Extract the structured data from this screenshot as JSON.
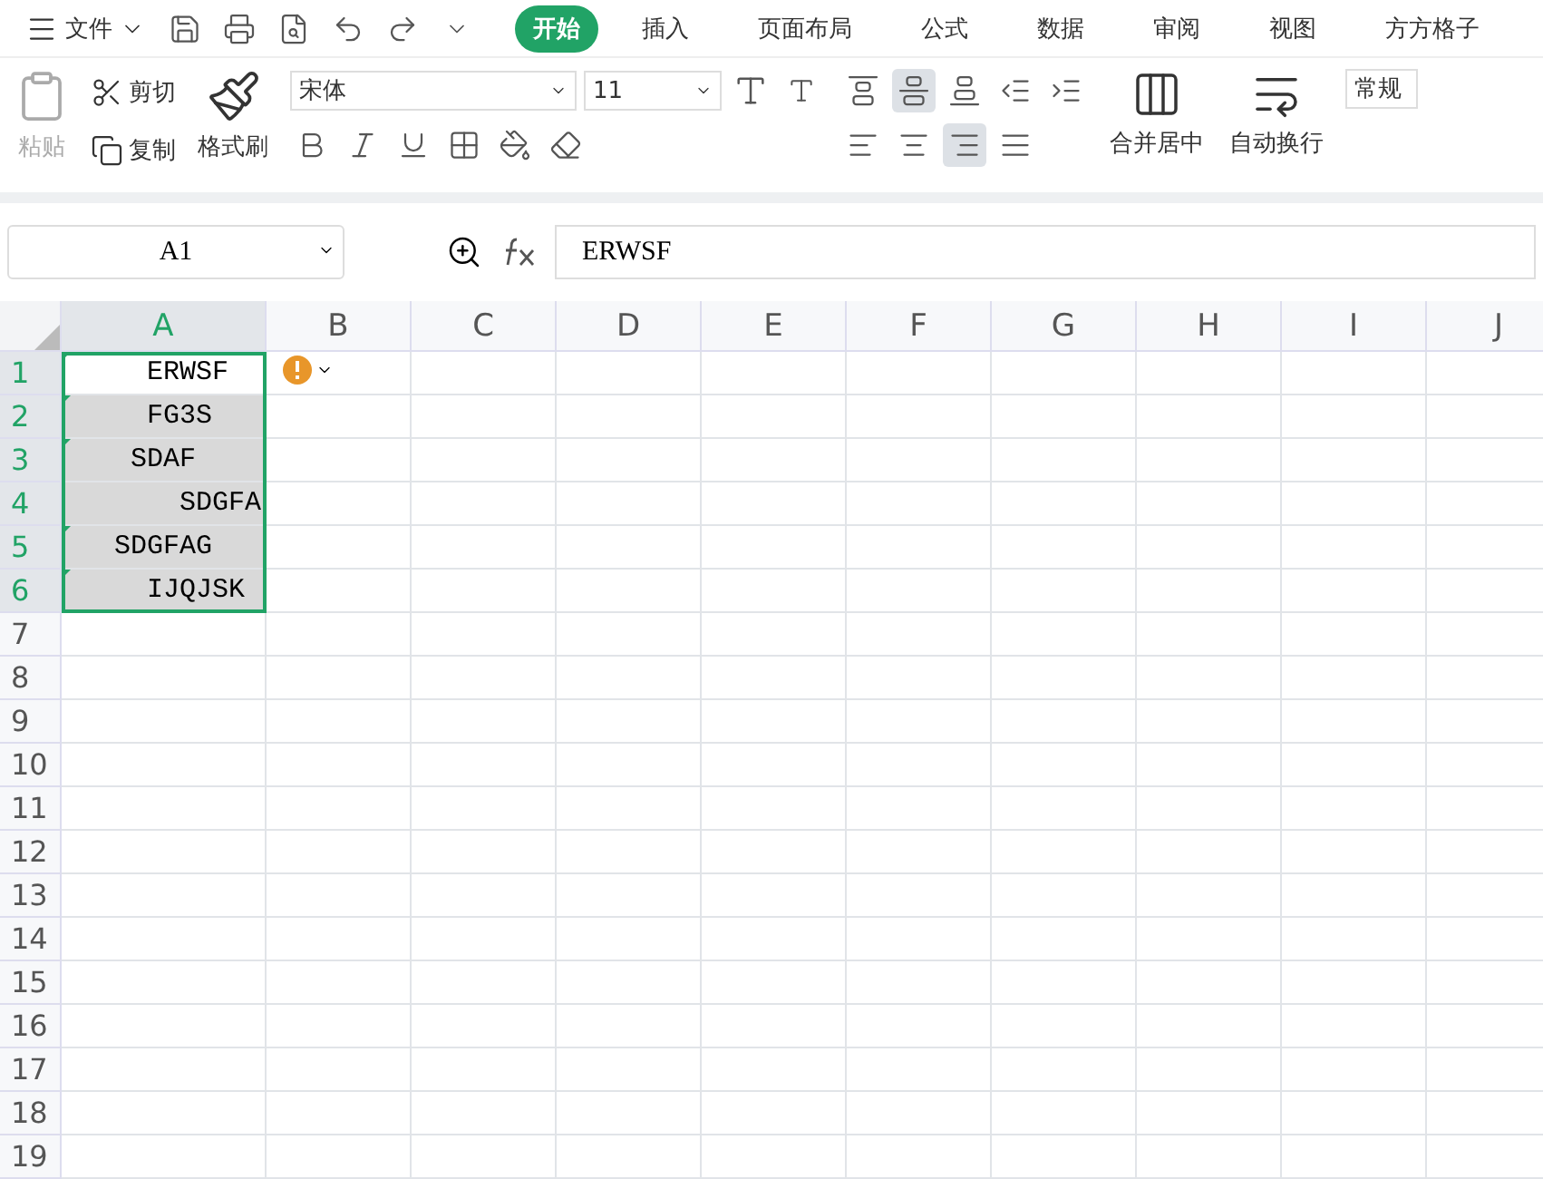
{
  "menu": {
    "label": "文件"
  },
  "tabs": [
    {
      "label": "开始",
      "selected": true
    },
    {
      "label": "插入",
      "selected": false
    },
    {
      "label": "页面布局",
      "selected": false
    },
    {
      "label": "公式",
      "selected": false
    },
    {
      "label": "数据",
      "selected": false
    },
    {
      "label": "审阅",
      "selected": false
    },
    {
      "label": "视图",
      "selected": false
    },
    {
      "label": "方方格子",
      "selected": false
    }
  ],
  "ribbon": {
    "paste": "粘贴",
    "cut": "剪切",
    "copy": "复制",
    "format_painter": "格式刷",
    "font_name": "宋体",
    "font_size": "11",
    "merge": "合并居中",
    "wrap": "自动换行",
    "number_format": "常规",
    "vertical_align": [
      {
        "kind": "top",
        "selected": false
      },
      {
        "kind": "middle",
        "selected": true
      },
      {
        "kind": "bottom",
        "selected": false
      }
    ],
    "horizontal_align": [
      {
        "kind": "left",
        "selected": false
      },
      {
        "kind": "center",
        "selected": false
      },
      {
        "kind": "right",
        "selected": true
      },
      {
        "kind": "justify",
        "selected": false
      }
    ]
  },
  "formula_bar": {
    "name_box": "A1",
    "formula": "ERWSF"
  },
  "columns": [
    {
      "label": "A",
      "selected": true
    },
    {
      "label": "B",
      "selected": false
    },
    {
      "label": "C",
      "selected": false
    },
    {
      "label": "D",
      "selected": false
    },
    {
      "label": "E",
      "selected": false
    },
    {
      "label": "F",
      "selected": false
    },
    {
      "label": "G",
      "selected": false
    },
    {
      "label": "H",
      "selected": false
    },
    {
      "label": "I",
      "selected": false
    },
    {
      "label": "J",
      "selected": false
    }
  ],
  "rows": [
    {
      "label": "1",
      "selected": true,
      "cell": {
        "value": "     ERWSF",
        "active": true,
        "error_flag": true
      }
    },
    {
      "label": "2",
      "selected": true,
      "cell": {
        "value": "     FG3S",
        "active": false,
        "error_flag": true
      }
    },
    {
      "label": "3",
      "selected": true,
      "cell": {
        "value": "    SDAF",
        "active": false,
        "error_flag": true
      }
    },
    {
      "label": "4",
      "selected": true,
      "cell": {
        "value": "       SDGFA",
        "active": false,
        "error_flag": false
      }
    },
    {
      "label": "5",
      "selected": true,
      "cell": {
        "value": "   SDGFAG",
        "active": false,
        "error_flag": true
      }
    },
    {
      "label": "6",
      "selected": true,
      "cell": {
        "value": "     IJQJSK",
        "active": false,
        "error_flag": true
      }
    },
    {
      "label": "7",
      "selected": false
    },
    {
      "label": "8",
      "selected": false
    },
    {
      "label": "9",
      "selected": false
    },
    {
      "label": "10",
      "selected": false
    },
    {
      "label": "11",
      "selected": false
    },
    {
      "label": "12",
      "selected": false
    },
    {
      "label": "13",
      "selected": false
    },
    {
      "label": "14",
      "selected": false
    },
    {
      "label": "15",
      "selected": false
    },
    {
      "label": "16",
      "selected": false
    },
    {
      "label": "17",
      "selected": false
    },
    {
      "label": "18",
      "selected": false
    },
    {
      "label": "19",
      "selected": false
    }
  ]
}
